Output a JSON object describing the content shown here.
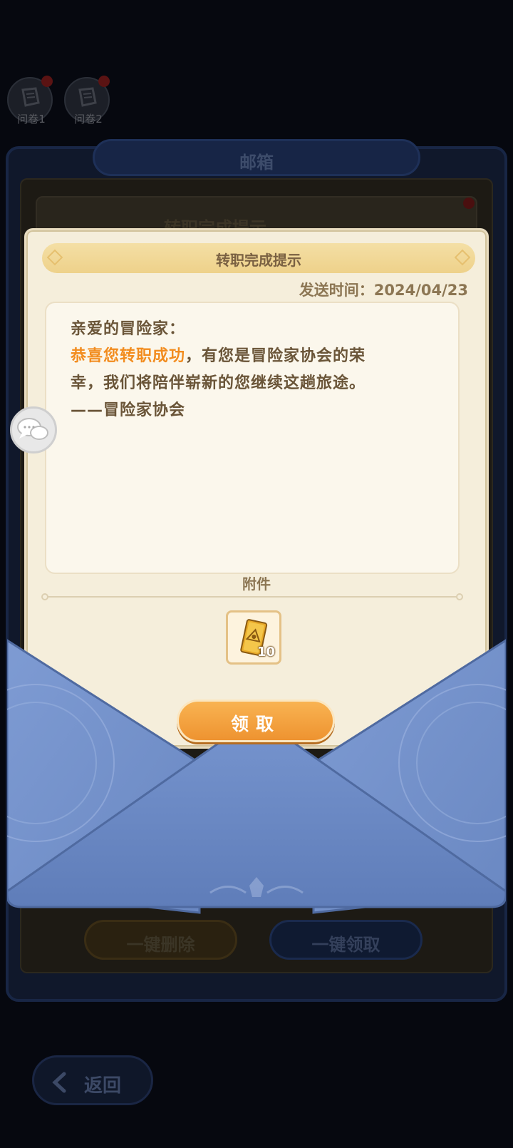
{
  "surveys": [
    {
      "label": "问卷1"
    },
    {
      "label": "问卷2"
    }
  ],
  "mailbox": {
    "title": "邮箱",
    "list_item_title": "转职完成提示",
    "delete_all_label": "一键删除",
    "claim_all_label": "一键领取"
  },
  "back": {
    "label": "返回"
  },
  "letter": {
    "title": "转职完成提示",
    "send_time": "发送时间：2024/04/23",
    "body": {
      "greeting": "亲爱的冒险家：",
      "highlight": "恭喜您转职成功",
      "line1_rest": "，有您是冒险家协会的荣",
      "line2": "幸，我们将陪伴崭新的您继续这趟旅途。",
      "signature": "——冒险家协会"
    },
    "attachment_label": "附件",
    "attachment": {
      "icon": "job-card-icon",
      "count": "10"
    },
    "claim_label": "领取"
  },
  "colors": {
    "accent_orange": "#f28c1e",
    "envelope_blue": "#6f8fc9",
    "paper": "#f5eedb"
  }
}
